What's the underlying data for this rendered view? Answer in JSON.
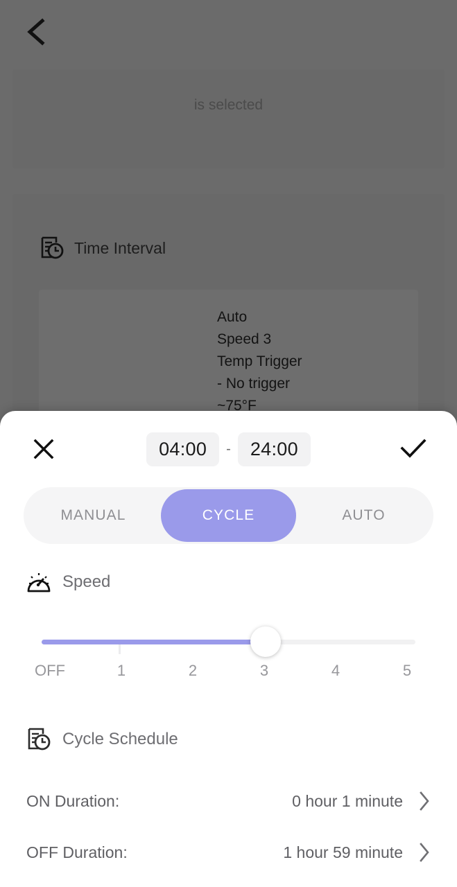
{
  "background": {
    "back_icon": "chevron-left-icon",
    "selected_text": "is selected",
    "time_interval_label": "Time Interval",
    "time_interval_icon": "schedule-clock-icon",
    "summary_text": "Auto\nSpeed 3\nTemp Trigger\n- No trigger\n~75°F"
  },
  "sheet": {
    "header": {
      "close_icon": "close-icon",
      "confirm_icon": "check-icon",
      "start_time": "04:00",
      "separator": "-",
      "end_time": "24:00"
    },
    "mode_tabs": [
      {
        "label": "MANUAL",
        "active": false
      },
      {
        "label": "CYCLE",
        "active": true
      },
      {
        "label": "AUTO",
        "active": false
      }
    ],
    "speed": {
      "icon": "speedometer-icon",
      "label": "Speed",
      "value": 3,
      "min": 0,
      "max": 5,
      "tick_labels": [
        "OFF",
        "1",
        "2",
        "3",
        "4",
        "5"
      ]
    },
    "cycle_schedule": {
      "icon": "schedule-clock-icon",
      "label": "Cycle Schedule",
      "rows": [
        {
          "label": "ON Duration:",
          "value": "0 hour 1 minute",
          "chevron": "chevron-right-icon"
        },
        {
          "label": "OFF Duration:",
          "value": "1 hour 59 minute",
          "chevron": "chevron-right-icon"
        }
      ]
    }
  },
  "colors": {
    "accent": "#9a9aea",
    "backdrop": "#6b6b6b",
    "chip_bg": "#f2f2f3",
    "track_bg": "#f1f1f2"
  }
}
